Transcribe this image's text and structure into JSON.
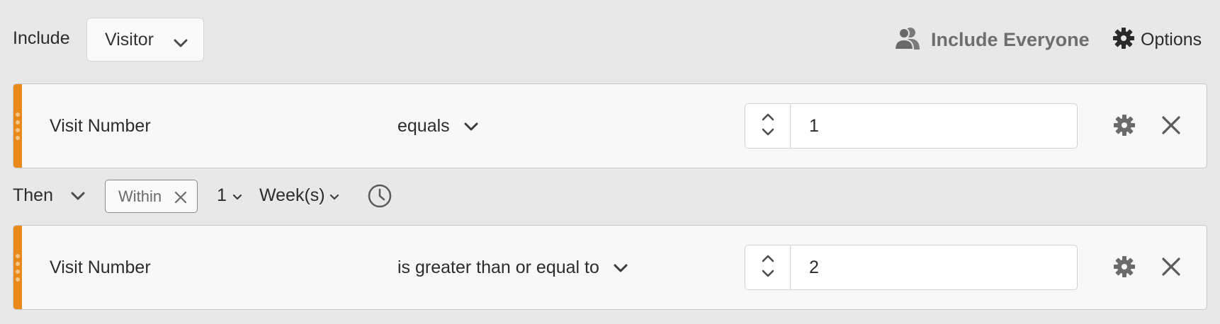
{
  "header": {
    "include_label": "Include",
    "container_select": "Visitor",
    "include_everyone": "Include Everyone",
    "options": "Options"
  },
  "rules": [
    {
      "dimension": "Visit Number",
      "operator": "equals",
      "value": "1"
    },
    {
      "dimension": "Visit Number",
      "operator": "is greater than or equal to",
      "value": "2"
    }
  ],
  "then": {
    "label": "Then",
    "within_tag": "Within",
    "count": "1",
    "unit": "Week(s)"
  },
  "colors": {
    "accent": "#e8891a",
    "background": "#e8e8e8",
    "rule_background": "#f8f8f8"
  },
  "icons": [
    "users-icon",
    "gear-icon",
    "chevron-down-icon",
    "stepper-up-icon",
    "stepper-down-icon",
    "close-icon",
    "clock-icon",
    "drag-handle-icon"
  ]
}
